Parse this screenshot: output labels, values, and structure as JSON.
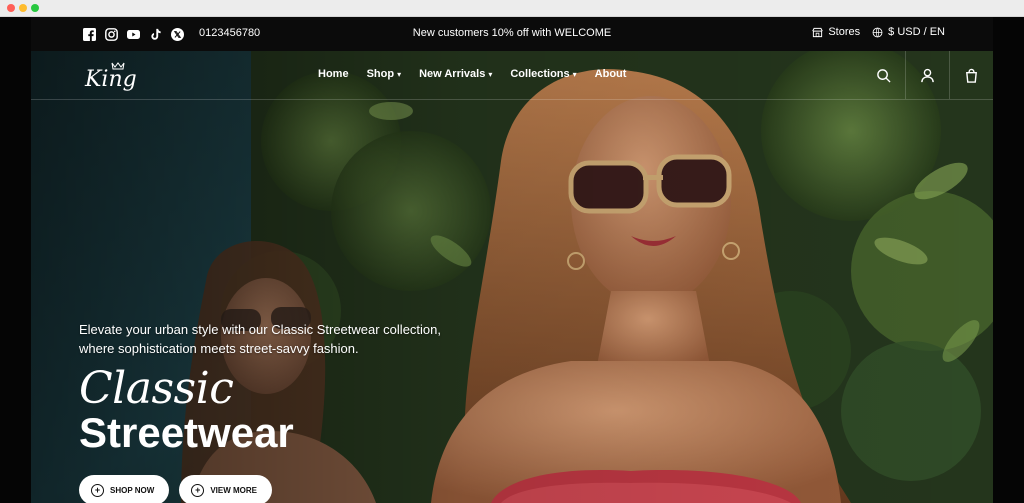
{
  "topbar": {
    "social_icons": [
      "facebook-icon",
      "instagram-icon",
      "youtube-icon",
      "tiktok-icon",
      "x-icon"
    ],
    "phone": "0123456780",
    "promo": "New customers 10% off with WELCOME",
    "stores_label": "Stores",
    "currency_language": "$ USD / EN"
  },
  "nav": {
    "logo_text": "King",
    "items": [
      {
        "label": "Home",
        "has_dropdown": false
      },
      {
        "label": "Shop",
        "has_dropdown": true
      },
      {
        "label": "New Arrivals",
        "has_dropdown": true
      },
      {
        "label": "Collections",
        "has_dropdown": true
      },
      {
        "label": "About",
        "has_dropdown": false
      }
    ],
    "icons": [
      "search-icon",
      "account-icon",
      "cart-icon"
    ],
    "dropdown_caret": "▾"
  },
  "hero": {
    "description": "Elevate your urban style with our Classic Streetwear collection, where sophistication meets street-savvy fashion.",
    "title_italic": "Classic",
    "title_bold": "Streetwear",
    "buttons": [
      {
        "label": "SHOP NOW",
        "icon": "plus-circle-icon"
      },
      {
        "label": "VIEW MORE",
        "icon": "plus-circle-icon"
      }
    ]
  },
  "colors": {
    "topbar_bg": "#0b0b0b",
    "text": "#ffffff",
    "button_bg": "#ffffff",
    "button_text": "#111111"
  }
}
